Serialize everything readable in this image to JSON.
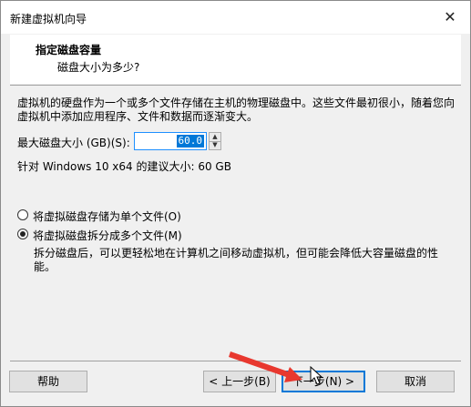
{
  "window": {
    "title": "新建虚拟机向导",
    "close_glyph": "✕"
  },
  "header": {
    "title": "指定磁盘容量",
    "subtitle": "磁盘大小为多少?"
  },
  "content": {
    "description": "虚拟机的硬盘作为一个或多个文件存储在主机的物理磁盘中。这些文件最初很小，随着您向虚拟机中添加应用程序、文件和数据而逐渐变大。",
    "size_label": "最大磁盘大小 (GB)(S):",
    "size_value": "60.0",
    "recommend_text": "针对 Windows 10 x64 的建议大小: 60 GB",
    "radio_single": "将虚拟磁盘存储为单个文件(O)",
    "radio_split": "将虚拟磁盘拆分成多个文件(M)",
    "split_description": "拆分磁盘后，可以更轻松地在计算机之间移动虚拟机，但可能会降低大容量磁盘的性能。",
    "selected_option": "split"
  },
  "buttons": {
    "help": "帮助",
    "back": "< 上一步(B)",
    "next": "下一步(N) >",
    "cancel": "取消"
  },
  "annotation": {
    "arrow_color": "#e8382f",
    "cursor_icon": "mouse-pointer-icon"
  }
}
